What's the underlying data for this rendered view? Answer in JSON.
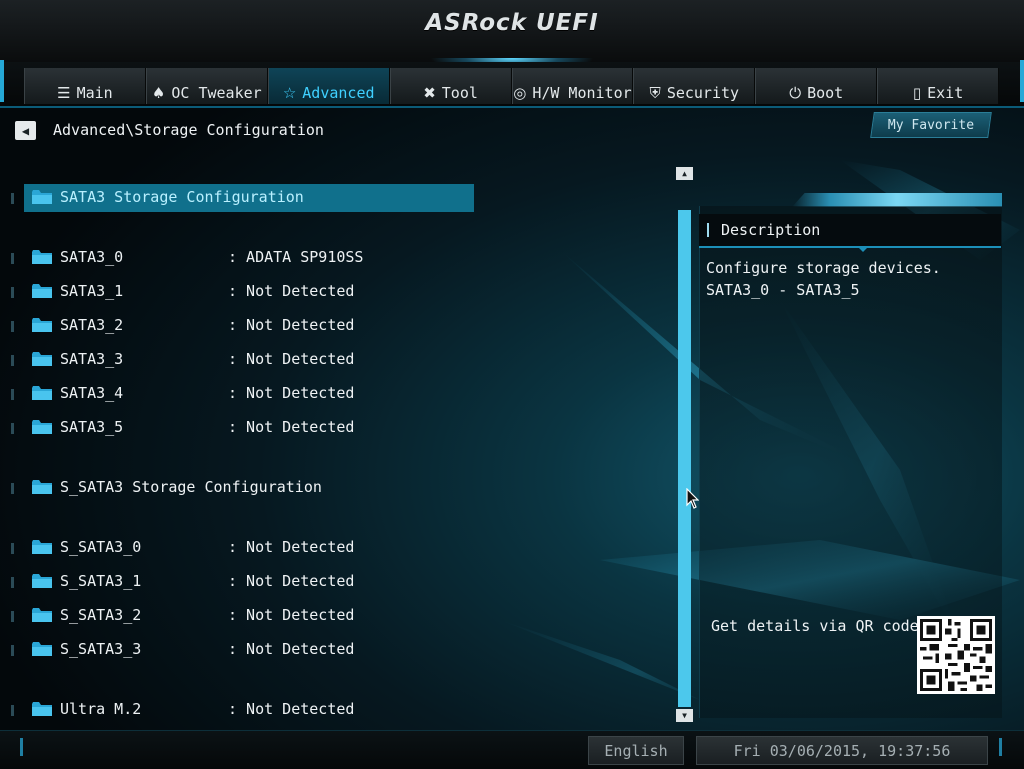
{
  "header": {
    "brand": "ASRock UEFI"
  },
  "nav": {
    "active_tab": "Advanced",
    "tabs": [
      {
        "label": "Main",
        "icon": "list-icon"
      },
      {
        "label": "OC Tweaker",
        "icon": "rocket-icon"
      },
      {
        "label": "Advanced",
        "icon": "star-icon"
      },
      {
        "label": "Tool",
        "icon": "tools-icon"
      },
      {
        "label": "H/W Monitor",
        "icon": "monitor-icon"
      },
      {
        "label": "Security",
        "icon": "shield-icon"
      },
      {
        "label": "Boot",
        "icon": "power-icon"
      },
      {
        "label": "Exit",
        "icon": "exit-icon"
      }
    ]
  },
  "breadcrumb": {
    "path": "Advanced\\Storage Configuration"
  },
  "my_favorite_label": "My Favorite",
  "items": [
    {
      "label": "SATA3 Storage Configuration",
      "value": "",
      "selected": true
    },
    {
      "label": "SATA3_0",
      "value": ": ADATA SP910SS"
    },
    {
      "label": "SATA3_1",
      "value": ": Not Detected"
    },
    {
      "label": "SATA3_2",
      "value": ": Not Detected"
    },
    {
      "label": "SATA3_3",
      "value": ": Not Detected"
    },
    {
      "label": "SATA3_4",
      "value": ": Not Detected"
    },
    {
      "label": "SATA3_5",
      "value": ": Not Detected"
    },
    {
      "label": "S_SATA3 Storage Configuration",
      "value": ""
    },
    {
      "label": "S_SATA3_0",
      "value": ": Not Detected"
    },
    {
      "label": "S_SATA3_1",
      "value": ": Not Detected"
    },
    {
      "label": "S_SATA3_2",
      "value": ": Not Detected"
    },
    {
      "label": "S_SATA3_3",
      "value": ": Not Detected"
    },
    {
      "label": "Ultra M.2",
      "value": ": Not Detected"
    }
  ],
  "description": {
    "title": "Description",
    "line1": "Configure storage devices.",
    "line2": "SATA3_0 - SATA3_5",
    "qr_label": "Get details via QR code"
  },
  "footer": {
    "language": "English",
    "datetime": "Fri 03/06/2015, 19:37:56"
  },
  "colors": {
    "accent": "#10708c",
    "highlight_text": "#3fd0ff",
    "scrollbar": "#4cc8ec"
  }
}
